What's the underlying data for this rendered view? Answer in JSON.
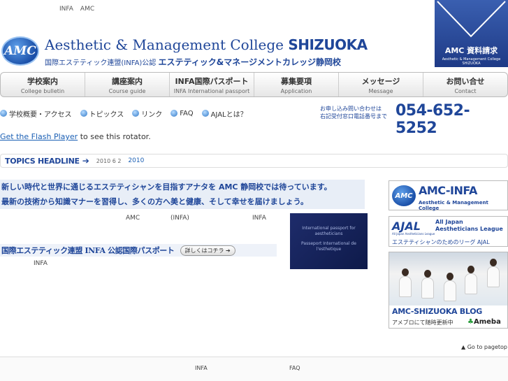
{
  "top_links": [
    "INFA",
    "AMC"
  ],
  "header": {
    "logo_text": "AMC",
    "college_name": "Aesthetic & Management College",
    "college_city": "SHIZUOKA",
    "college_sub_a": "国際エステティック連盟(INFA)公認",
    "college_sub_b": "エステティック&マネージメントカレッジ静岡校"
  },
  "request": {
    "title": "AMC 資料請求",
    "sub": "Aesthetic & Management College SHIZUOKA"
  },
  "nav": [
    {
      "jp": "学校案内",
      "en": "College bulletin"
    },
    {
      "jp": "講座案内",
      "en": "Course guide"
    },
    {
      "jp": "INFA国際パスポート",
      "en": "INFA International passport"
    },
    {
      "jp": "募集要項",
      "en": "Application"
    },
    {
      "jp": "メッセージ",
      "en": "Message"
    },
    {
      "jp": "お問い合せ",
      "en": "Contact"
    }
  ],
  "sub_links": [
    "学校概要・アクセス",
    "トピックス",
    "リンク",
    "FAQ",
    "AJALとは？"
  ],
  "contact": {
    "label_line1": "お申し込み問い合わせは",
    "label_line2": "右記受付窓口電話番号まで",
    "phone": "054-652-5252"
  },
  "flash": {
    "link": "Get the Flash Player",
    "text": " to see this rotator."
  },
  "topics": {
    "title": "TOPICS HEADLINE",
    "date": "2010 6 2",
    "link": "2010"
  },
  "main": {
    "catch1": "新しい時代と世界に通じるエステティシャンを目指すアナタを AMC 静岡校では待っています。",
    "catch2": "最新の技術から知識マナーを習得し、多くの方へ美と健康、そして幸せを届けましょう。",
    "mini_amc": "AMC",
    "mini_infa": "(INFA)",
    "mini_infa2": "INFA",
    "passport_title": "国際エステティック連盟 INFA 公認国際パスポート",
    "more_button": "詳しくはコチラ ➔",
    "infa_small": "INFA",
    "passport_img_line1": "International passport for aestheticians",
    "passport_img_line2": "Passeport International de l'esthetique"
  },
  "banners": {
    "infa_logo": "AMC",
    "infa_title": "AMC-INFA",
    "infa_sub": "Aesthetic & Management College",
    "ajal_logo": "AJAL",
    "ajal_logo_sub": "All Japan Aestheticians League",
    "ajal_title1": "All Japan",
    "ajal_title2": "Aestheticians League",
    "ajal_sub": "エステティシャンのためのリーグ AJAL",
    "blog_title": "AMC-SHIZUOKA BLOG",
    "blog_sub": "アメブロにて随時更新中",
    "ameba": "Ameba"
  },
  "pagetop": "Go to pagetop",
  "footer": {
    "infa": "INFA",
    "faq": "FAQ"
  }
}
